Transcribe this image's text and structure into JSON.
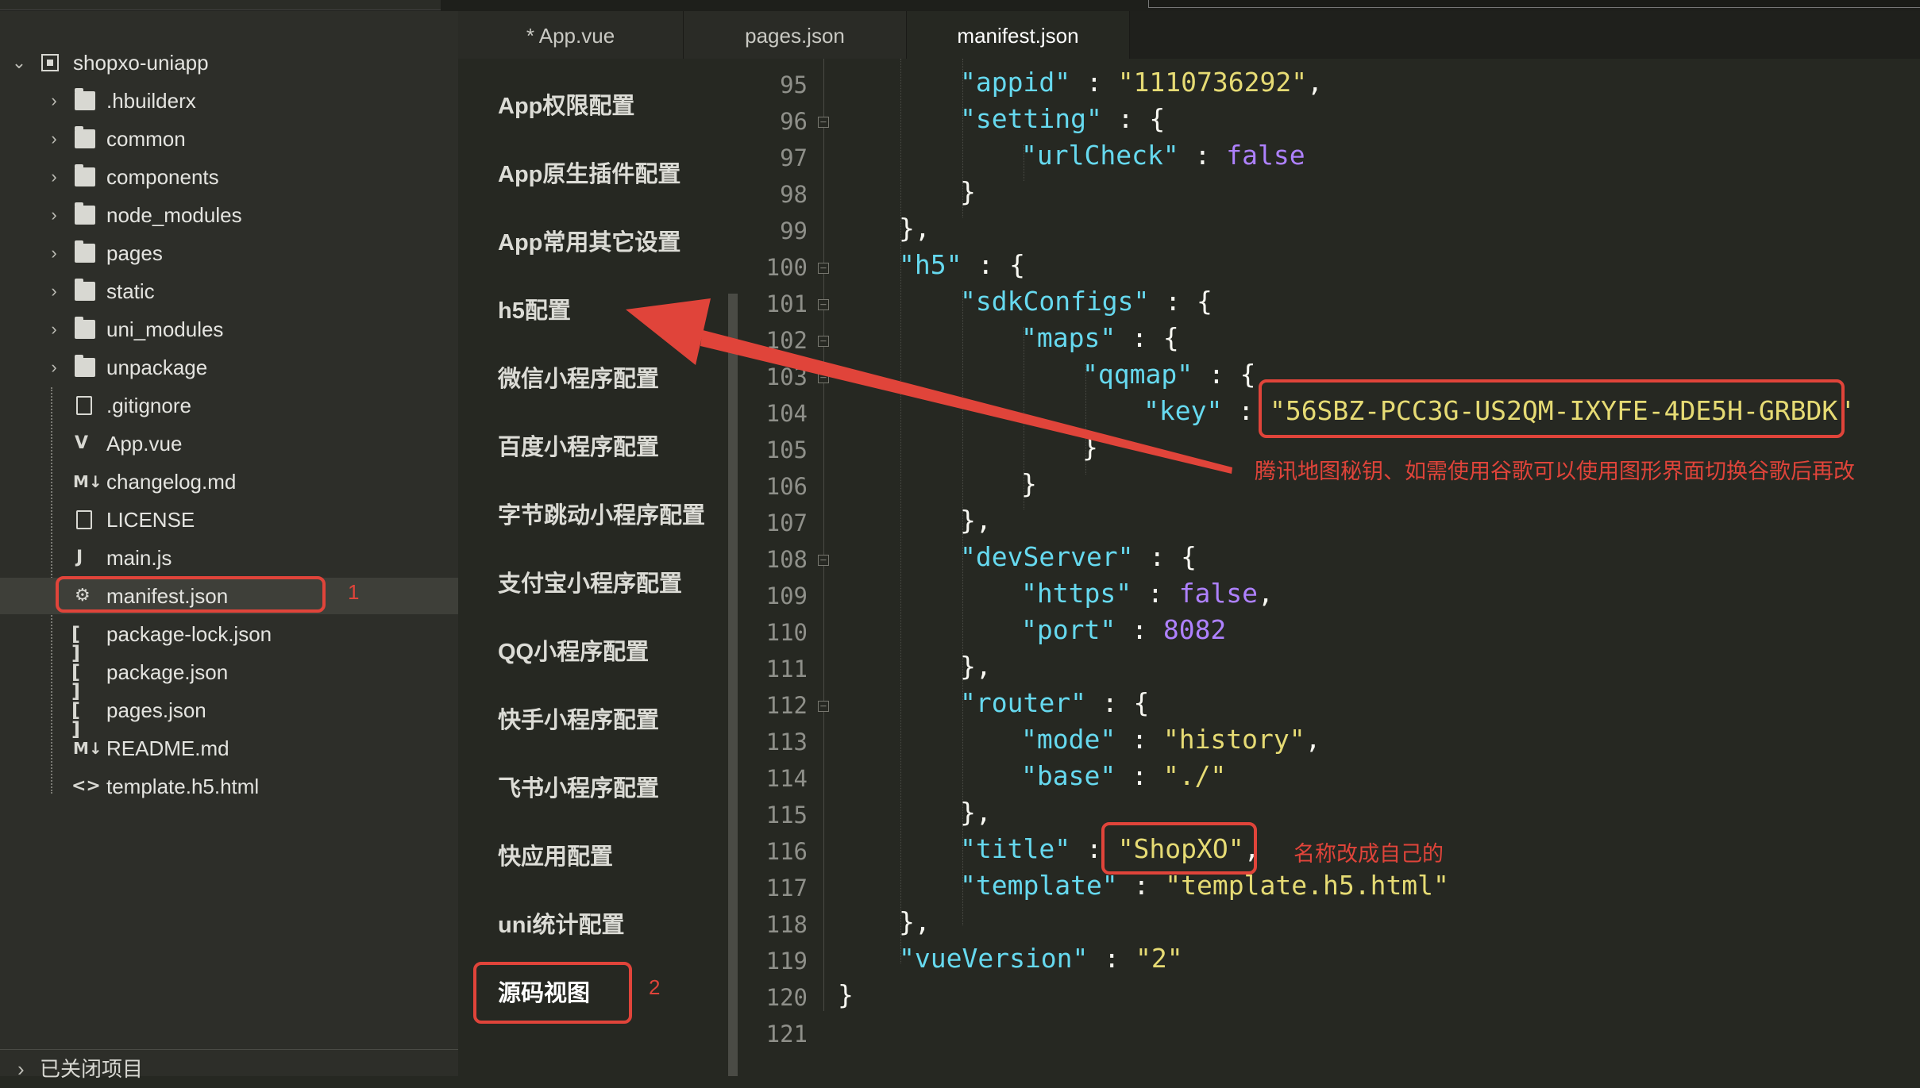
{
  "sidebar": {
    "project_name": "shopxo-uniapp",
    "items": [
      {
        "label": ".hbuilderx",
        "type": "folder"
      },
      {
        "label": "common",
        "type": "folder"
      },
      {
        "label": "components",
        "type": "folder"
      },
      {
        "label": "node_modules",
        "type": "folder"
      },
      {
        "label": "pages",
        "type": "folder"
      },
      {
        "label": "static",
        "type": "folder"
      },
      {
        "label": "uni_modules",
        "type": "folder"
      },
      {
        "label": "unpackage",
        "type": "folder"
      },
      {
        "label": ".gitignore",
        "type": "file"
      },
      {
        "label": "App.vue",
        "type": "vue"
      },
      {
        "label": "changelog.md",
        "type": "md"
      },
      {
        "label": "LICENSE",
        "type": "file"
      },
      {
        "label": "main.js",
        "type": "js"
      },
      {
        "label": "manifest.json",
        "type": "config"
      },
      {
        "label": "package-lock.json",
        "type": "json"
      },
      {
        "label": "package.json",
        "type": "json"
      },
      {
        "label": "pages.json",
        "type": "json"
      },
      {
        "label": "README.md",
        "type": "md"
      },
      {
        "label": "template.h5.html",
        "type": "html"
      }
    ],
    "icons": {
      "vue": "V",
      "md": "M↓",
      "js": "J",
      "config": "⚙",
      "json": "[ ]",
      "html": "<>"
    },
    "closed_projects": "已关闭项目",
    "annotation_1": "1",
    "annotation_2": "2"
  },
  "tabs": [
    {
      "label": "* App.vue"
    },
    {
      "label": "pages.json"
    },
    {
      "label": "manifest.json"
    }
  ],
  "settings_nav": [
    "App权限配置",
    "App原生插件配置",
    "App常用其它设置",
    "h5配置",
    "微信小程序配置",
    "百度小程序配置",
    "字节跳动小程序配置",
    "支付宝小程序配置",
    "QQ小程序配置",
    "快手小程序配置",
    "飞书小程序配置",
    "快应用配置",
    "uni统计配置",
    "源码视图"
  ],
  "editor": {
    "line_numbers": [
      "95",
      "96",
      "97",
      "98",
      "99",
      "100",
      "101",
      "102",
      "103",
      "104",
      "105",
      "106",
      "107",
      "108",
      "109",
      "110",
      "111",
      "112",
      "113",
      "114",
      "115",
      "116",
      "117",
      "118",
      "119",
      "120",
      "121"
    ],
    "code": {
      "l95_key": "\"appid\"",
      "l95_val": "\"1110736292\"",
      "l96_key": "\"setting\"",
      "l97_key": "\"urlCheck\"",
      "l97_val": "false",
      "l100_key": "\"h5\"",
      "l101_key": "\"sdkConfigs\"",
      "l102_key": "\"maps\"",
      "l103_key": "\"qqmap\"",
      "l104_key": "\"key\"",
      "l104_val": "\"56SBZ-PCC3G-US2QM-IXYFE-4DE5H-GRBDK\"",
      "l108_key": "\"devServer\"",
      "l109_key": "\"https\"",
      "l109_val": "false",
      "l110_key": "\"port\"",
      "l110_val": "8082",
      "l112_key": "\"router\"",
      "l113_key": "\"mode\"",
      "l113_val": "\"history\"",
      "l114_key": "\"base\"",
      "l114_val": "\"./\"",
      "l116_key": "\"title\"",
      "l116_val": "\"ShopXO\"",
      "l117_key": "\"template\"",
      "l117_val": "\"template.h5.html\"",
      "l119_key": "\"vueVersion\"",
      "l119_val": "\"2\""
    }
  },
  "annotations": {
    "key_note": "腾讯地图秘钥、如需使用谷歌可以使用图形界面切换谷歌后再改",
    "title_note": "名称改成自己的"
  },
  "colors": {
    "annotation_red": "#e0443a",
    "key_color": "#66d9ef",
    "string_color": "#e6db74",
    "literal_color": "#ae81ff"
  }
}
